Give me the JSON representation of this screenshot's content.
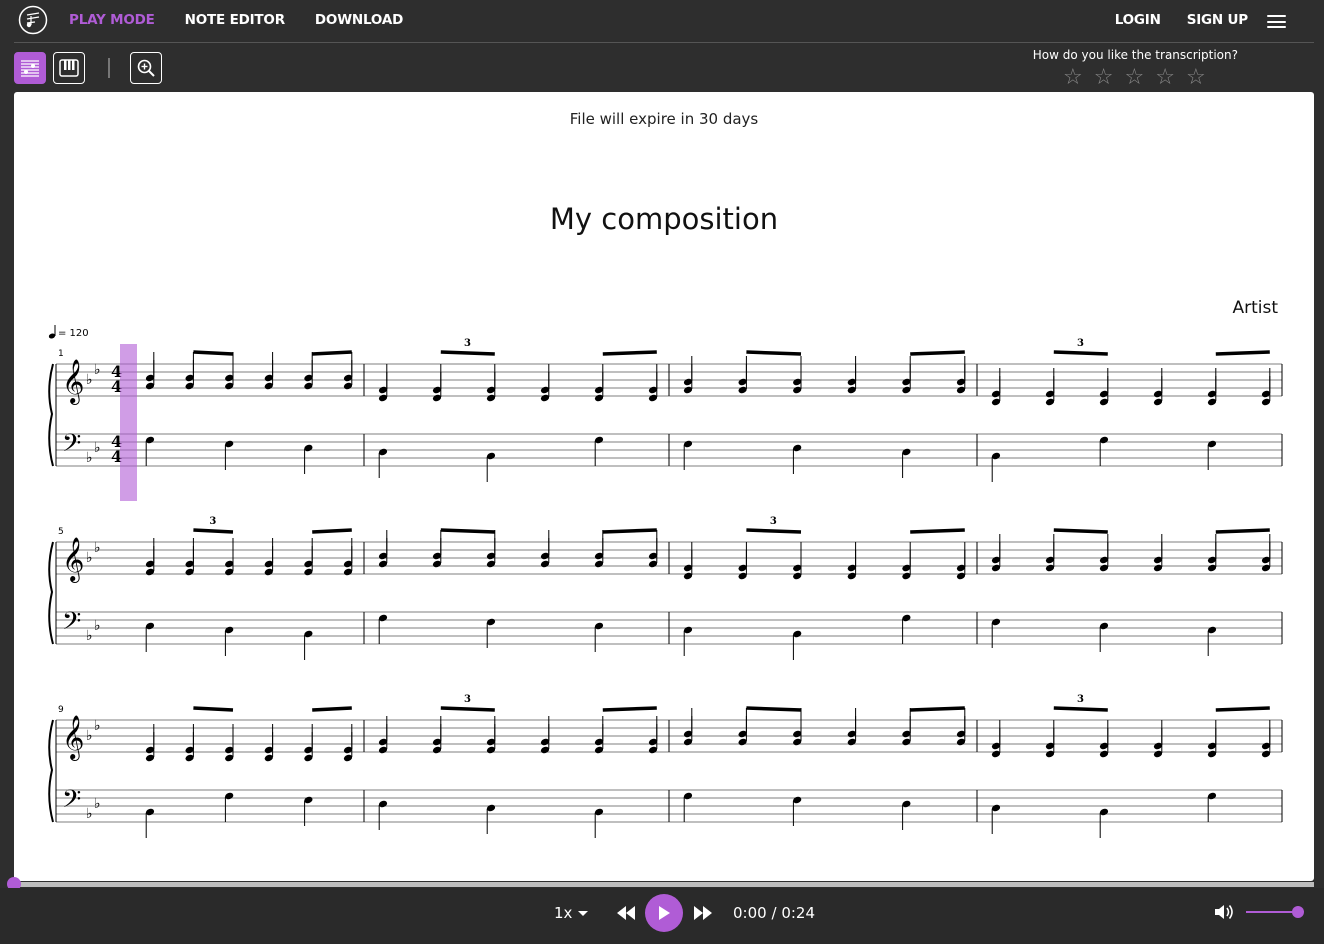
{
  "nav": {
    "items": [
      {
        "label": "PLAY MODE",
        "active": true
      },
      {
        "label": "NOTE EDITOR",
        "active": false
      },
      {
        "label": "DOWNLOAD",
        "active": false
      }
    ],
    "login": "LOGIN",
    "signup": "SIGN UP",
    "accent_color": "#b05cd6"
  },
  "toolbar": {
    "buttons": [
      {
        "icon": "sheet-music-icon",
        "active": true
      },
      {
        "icon": "piano-keys-icon",
        "active": false
      },
      {
        "icon": "zoom-in-icon",
        "active": false
      }
    ]
  },
  "rating": {
    "question": "How do you like the transcription?",
    "stars": [
      "☆",
      "☆",
      "☆",
      "☆",
      "☆"
    ],
    "selected": 0
  },
  "sheet": {
    "expire_notice": "File will expire in 30 days",
    "title": "My composition",
    "artist": "Artist",
    "tempo_marking": "= 120",
    "time_signature": "4/4",
    "key_signature": "B♭ major (2 flats)",
    "measure_numbers": [
      "1",
      "5",
      "9"
    ],
    "tuplet_label": "3"
  },
  "player": {
    "speed": "1x",
    "current_time": "0:00",
    "separator": "/",
    "total_time": "0:24",
    "progress": 0,
    "volume": 1
  }
}
